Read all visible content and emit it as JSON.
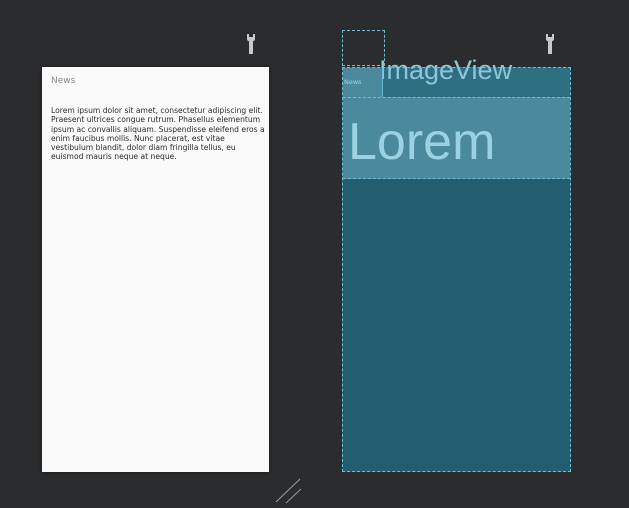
{
  "design_view": {
    "title": "News",
    "body": "Lorem ipsum dolor sit amet, consectetur adipiscing elit. Praesent ultrices congue rutrum. Phasellus elementum ipsum ac convallis aliquam. Suspendisse eleifend eros a enim faucibus mollis. Nunc placerat, est vitae vestibulum blandit, dolor diam fringilla tellus, eu euismod mauris neque at neque."
  },
  "blueprint_view": {
    "news_label": "News",
    "imageview_label": "ImageView",
    "lorem_label": "Lorem"
  },
  "colors": {
    "canvas_background": "#2b2c2e",
    "design_surface": "#fafafa",
    "blueprint_background": "#235e70",
    "blueprint_highlight": "#4a8a9c",
    "blueprint_outline": "#6cbcd4"
  },
  "icons": {
    "left_toolbar": "wrench-icon",
    "right_toolbar": "wrench-icon",
    "resize": "resize-handle-icon"
  }
}
